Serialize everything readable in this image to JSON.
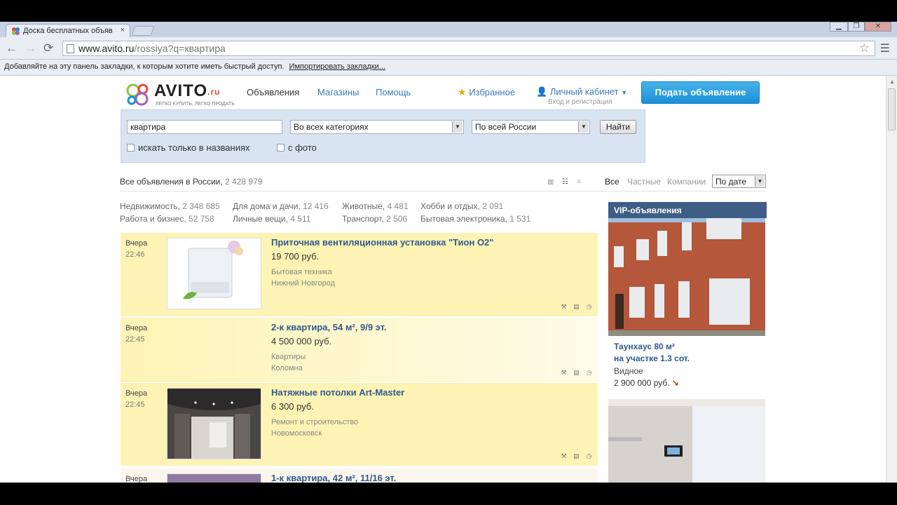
{
  "browser": {
    "tab_title": "Доска бесплатных объяв",
    "tab_close": "×",
    "url_host": "www.avito.ru",
    "url_path": "/rossiya?q=квартира",
    "bookmarks_text": "Добавляйте на эту панель закладки, к которым хотите иметь быстрый доступ.",
    "bookmarks_link": "Импортировать закладки..."
  },
  "header": {
    "logo_name": "AVITO",
    "logo_suffix": ".ru",
    "logo_tagline": "ЛЕГКО КУПИТЬ, ЛЕГКО ПРОДАТЬ",
    "nav": [
      "Объявления",
      "Магазины",
      "Помощь"
    ],
    "favorites": "Избранное",
    "cabinet": "Личный кабинет",
    "cabinet_sub": "Вход и регистрация",
    "post_button": "Подать объявление"
  },
  "search": {
    "query": "квартира",
    "category": "Во всех категориях",
    "region": "По всей России",
    "find_button": "Найти",
    "only_titles": "искать только в названиях",
    "with_photo": "с фото"
  },
  "results": {
    "summary_label": "Все объявления в России,",
    "summary_count": "2 428 979",
    "filter_all": "Все",
    "filter_private": "Частные",
    "filter_companies": "Компании",
    "sort": "По дате"
  },
  "categories": [
    {
      "name": "Недвижимость,",
      "count": "2 348 685"
    },
    {
      "name": "Работа и бизнес,",
      "count": "52 758"
    },
    {
      "name": "Для дома и дачи,",
      "count": "12 416"
    },
    {
      "name": "Личные вещи,",
      "count": "4 511"
    },
    {
      "name": "Животные,",
      "count": "4 481"
    },
    {
      "name": "Транспорт,",
      "count": "2 506"
    },
    {
      "name": "Хобби и отдых,",
      "count": "2 091"
    },
    {
      "name": "Бытовая электроника,",
      "count": "1 531"
    }
  ],
  "listings": [
    {
      "day": "Вчера",
      "time": "22:46",
      "title": "Приточная вентиляционная установка \"Тион О2\"",
      "price": "19 700 руб.",
      "category": "Бытовая техника",
      "city": "Нижний Новгород"
    },
    {
      "day": "Вчера",
      "time": "22:45",
      "title": "2-к квартира, 54 м², 9/9 эт.",
      "price": "4 500 000 руб.",
      "category": "Квартиры",
      "city": "Коломна"
    },
    {
      "day": "Вчера",
      "time": "22:45",
      "title": "Натяжные потолки Art-Master",
      "price": "6 300 руб.",
      "category": "Ремонт и строительство",
      "city": "Новомосковск"
    },
    {
      "day": "Вчера",
      "title": "1-к квартира, 42 м², 11/16 эт."
    }
  ],
  "vip": {
    "header": "VIP-объявления",
    "title_line1": "Таунхаус 80 м²",
    "title_line2": "на участке 1.3 сот.",
    "location": "Видное",
    "price": "2 900 000 руб."
  },
  "colors": {
    "highlight": "#fdf3b5",
    "link": "#2f5a8e",
    "accent_button": "#1b8fd6",
    "search_panel": "#d8e4f1",
    "vip_header": "#3f5d85"
  }
}
